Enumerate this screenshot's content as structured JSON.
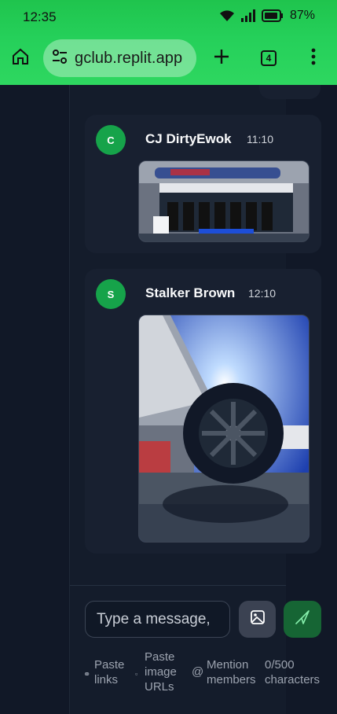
{
  "status_bar": {
    "time": "12:35",
    "battery": "87%"
  },
  "browser": {
    "url": "gclub.replit.app",
    "tab_count": "4"
  },
  "messages": [
    {
      "initial": "C",
      "author": "CJ DirtyEwok",
      "time": "11:10",
      "image_alt": "F1 pit wall with team members and ADMIN banner"
    },
    {
      "initial": "S",
      "author": "Stalker Brown",
      "time": "12:10",
      "image_alt": "Close-up of race car wheel under a tent in sunlight"
    }
  ],
  "composer": {
    "placeholder": "Type a message,",
    "hints": {
      "paste_links": "Paste links",
      "paste_image_urls": "Paste image URLs",
      "mention_members": "Mention members",
      "char_count": "0/500 characters"
    }
  },
  "colors": {
    "brand_green": "#16a34a",
    "bar_green": "#25d05a",
    "background": "#111827"
  }
}
